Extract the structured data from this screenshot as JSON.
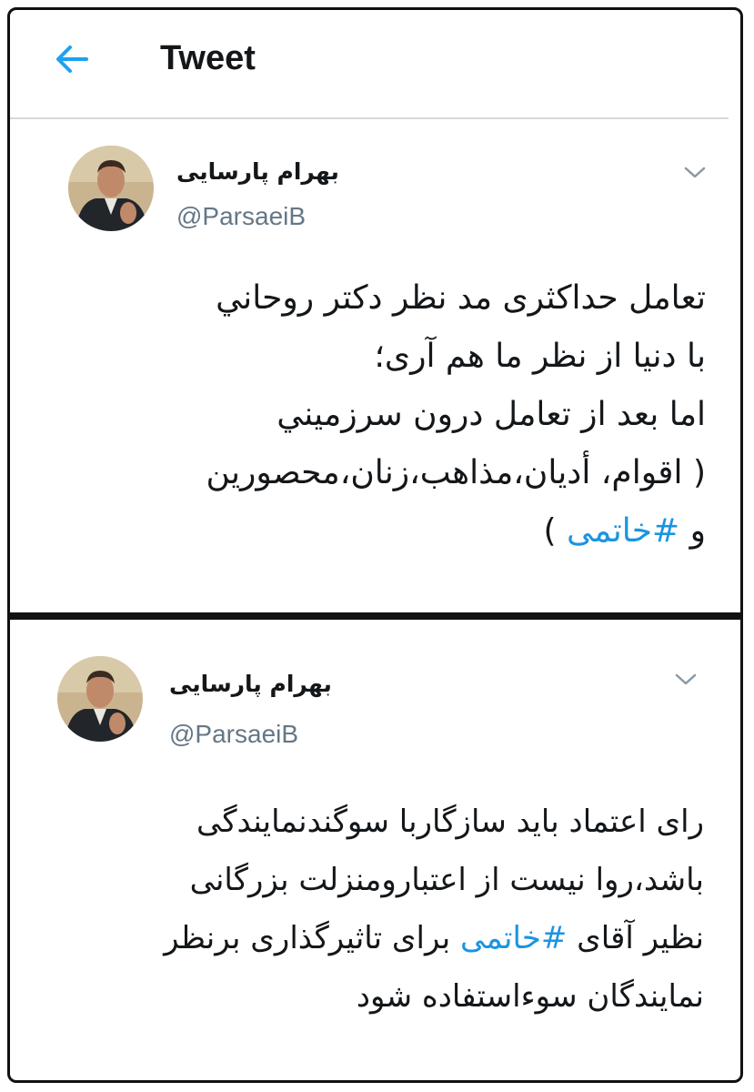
{
  "header": {
    "title": "Tweet",
    "back_icon": "arrow-left-icon",
    "accent_color": "#1da1f2"
  },
  "tweets": [
    {
      "author_name": "بهرام پارسایی",
      "handle": "@ParsaeiB",
      "caret_icon": "chevron-down-icon",
      "lines": [
        "تعامل حداكثری مد نظر دكتر روحاني",
        "با دنيا از نظر ما هم آری؛",
        "اما بعد از تعامل درون سرزميني",
        "( اقوام، أديان،مذاهب،زنان،محصورين"
      ],
      "last_line_prefix": "و ",
      "hashtag": "#خاتمی",
      "last_line_suffix": " )"
    },
    {
      "author_name": "بهرام پارسایی",
      "handle": "@ParsaeiB",
      "caret_icon": "chevron-down-icon",
      "line1": "رای اعتماد باید سازگاربا سوگندنمایندگی",
      "line2": "باشد،روا نیست از اعتبارومنزلت بزرگانی",
      "line3_prefix": "نظیر آقای ",
      "hashtag": "#خاتمی",
      "line3_suffix": " برای تاثیرگذاری برنظر",
      "line4": "نمایندگان سوءاستفاده شود"
    }
  ]
}
